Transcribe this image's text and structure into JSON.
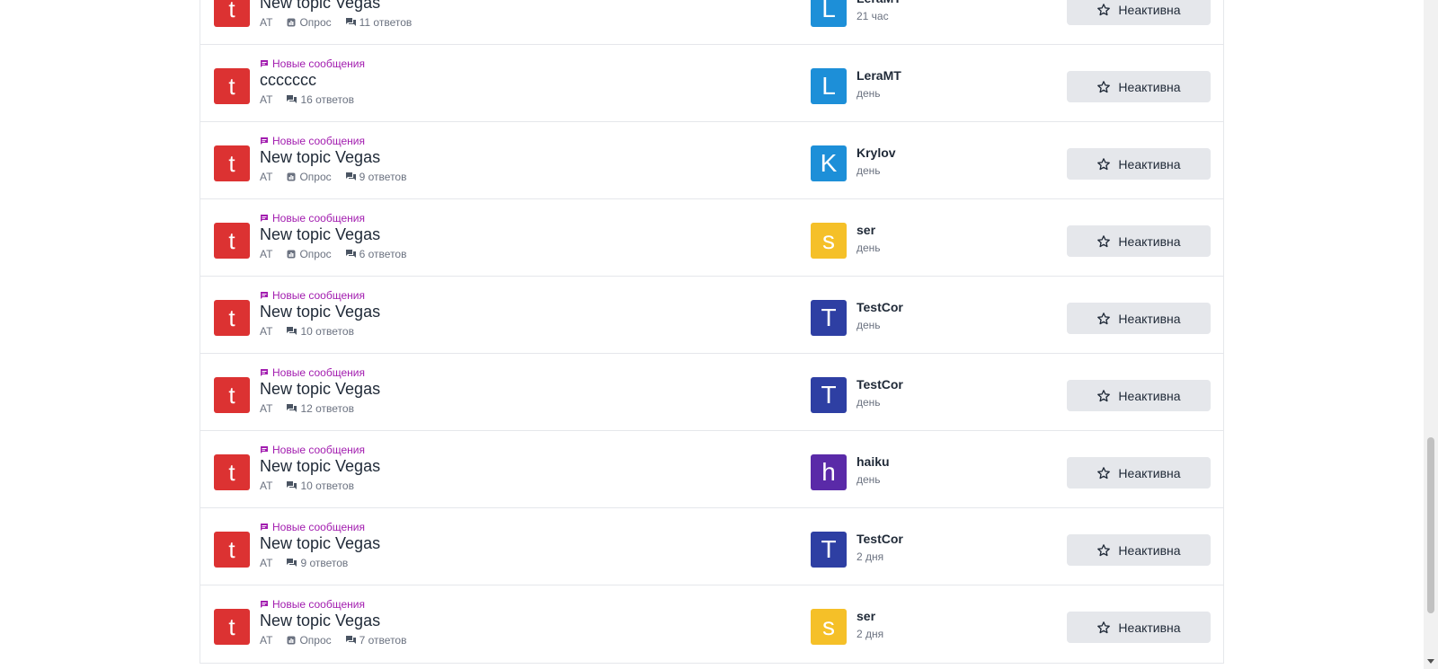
{
  "colors": {
    "topic_avatar": "#dc3232",
    "new_badge": "#a21caf",
    "avatar_L": "#1d8fd8",
    "avatar_K": "#1d8fd8",
    "avatar_s": "#f5c028",
    "avatar_T": "#2e3fa3",
    "avatar_h": "#5a2aa8"
  },
  "new_badge_label": "Новые сообщения",
  "fav_button_label": "Неактивна",
  "topics": [
    {
      "letter": "t",
      "new": false,
      "title": "New topic Vegas",
      "author": "AT",
      "poll": "Опрос",
      "replies": "11 ответов",
      "user_letter": "L",
      "user_color": "#1d8fd8",
      "user": "LeraMT",
      "time": "21 час"
    },
    {
      "letter": "t",
      "new": true,
      "title": "ccccccc",
      "author": "AT",
      "poll": "",
      "replies": "16 ответов",
      "user_letter": "L",
      "user_color": "#1d8fd8",
      "user": "LeraMT",
      "time": "день"
    },
    {
      "letter": "t",
      "new": true,
      "title": "New topic Vegas",
      "author": "AT",
      "poll": "Опрос",
      "replies": "9 ответов",
      "user_letter": "K",
      "user_color": "#1d8fd8",
      "user": "Krylov",
      "time": "день"
    },
    {
      "letter": "t",
      "new": true,
      "title": "New topic Vegas",
      "author": "AT",
      "poll": "Опрос",
      "replies": "6 ответов",
      "user_letter": "s",
      "user_color": "#f5c028",
      "user": "ser",
      "time": "день"
    },
    {
      "letter": "t",
      "new": true,
      "title": "New topic Vegas",
      "author": "AT",
      "poll": "",
      "replies": "10 ответов",
      "user_letter": "T",
      "user_color": "#2e3fa3",
      "user": "TestCor",
      "time": "день"
    },
    {
      "letter": "t",
      "new": true,
      "title": "New topic Vegas",
      "author": "AT",
      "poll": "",
      "replies": "12 ответов",
      "user_letter": "T",
      "user_color": "#2e3fa3",
      "user": "TestCor",
      "time": "день"
    },
    {
      "letter": "t",
      "new": true,
      "title": "New topic Vegas",
      "author": "AT",
      "poll": "",
      "replies": "10 ответов",
      "user_letter": "h",
      "user_color": "#5a2aa8",
      "user": "haiku",
      "time": "день"
    },
    {
      "letter": "t",
      "new": true,
      "title": "New topic Vegas",
      "author": "AT",
      "poll": "",
      "replies": "9 ответов",
      "user_letter": "T",
      "user_color": "#2e3fa3",
      "user": "TestCor",
      "time": "2 дня"
    },
    {
      "letter": "t",
      "new": true,
      "title": "New topic Vegas",
      "author": "AT",
      "poll": "Опрос",
      "replies": "7 ответов",
      "user_letter": "s",
      "user_color": "#f5c028",
      "user": "ser",
      "time": "2 дня"
    }
  ]
}
